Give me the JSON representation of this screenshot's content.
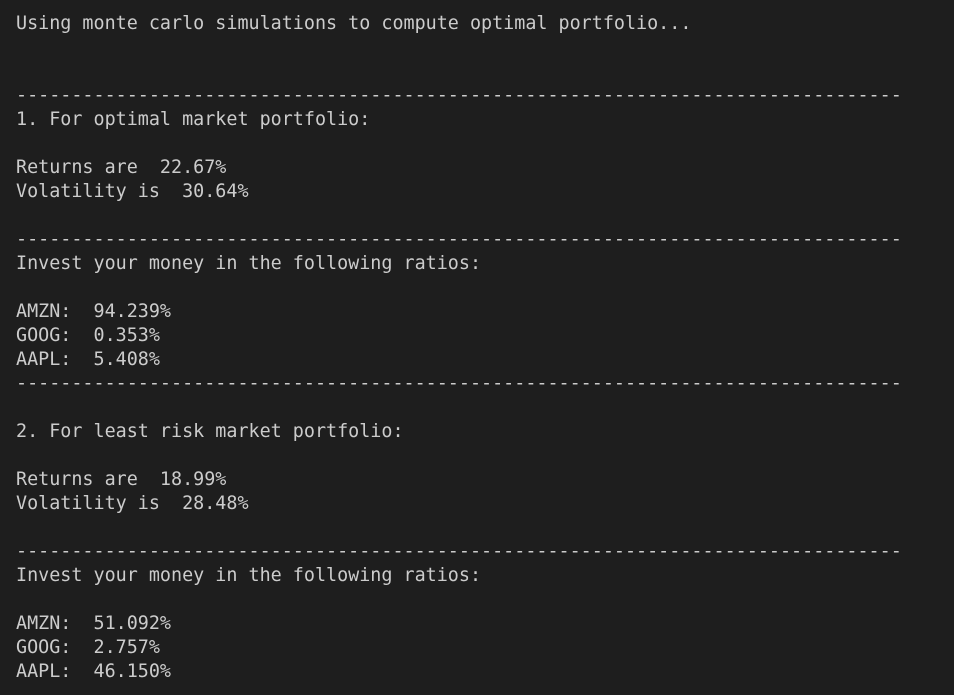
{
  "terminal": {
    "lines": [
      "Using monte carlo simulations to compute optimal portfolio...",
      "",
      "",
      "--------------------------------------------------------------------------------",
      "1. For optimal market portfolio:",
      "",
      "Returns are  22.67%",
      "Volatility is  30.64%",
      "",
      "--------------------------------------------------------------------------------",
      "Invest your money in the following ratios:",
      "",
      "AMZN:  94.239%",
      "GOOG:  0.353%",
      "AAPL:  5.408%",
      "--------------------------------------------------------------------------------",
      "",
      "2. For least risk market portfolio:",
      "",
      "Returns are  18.99%",
      "Volatility is  28.48%",
      "",
      "--------------------------------------------------------------------------------",
      "Invest your money in the following ratios:",
      "",
      "AMZN:  51.092%",
      "GOOG:  2.757%",
      "AAPL:  46.150%"
    ]
  }
}
